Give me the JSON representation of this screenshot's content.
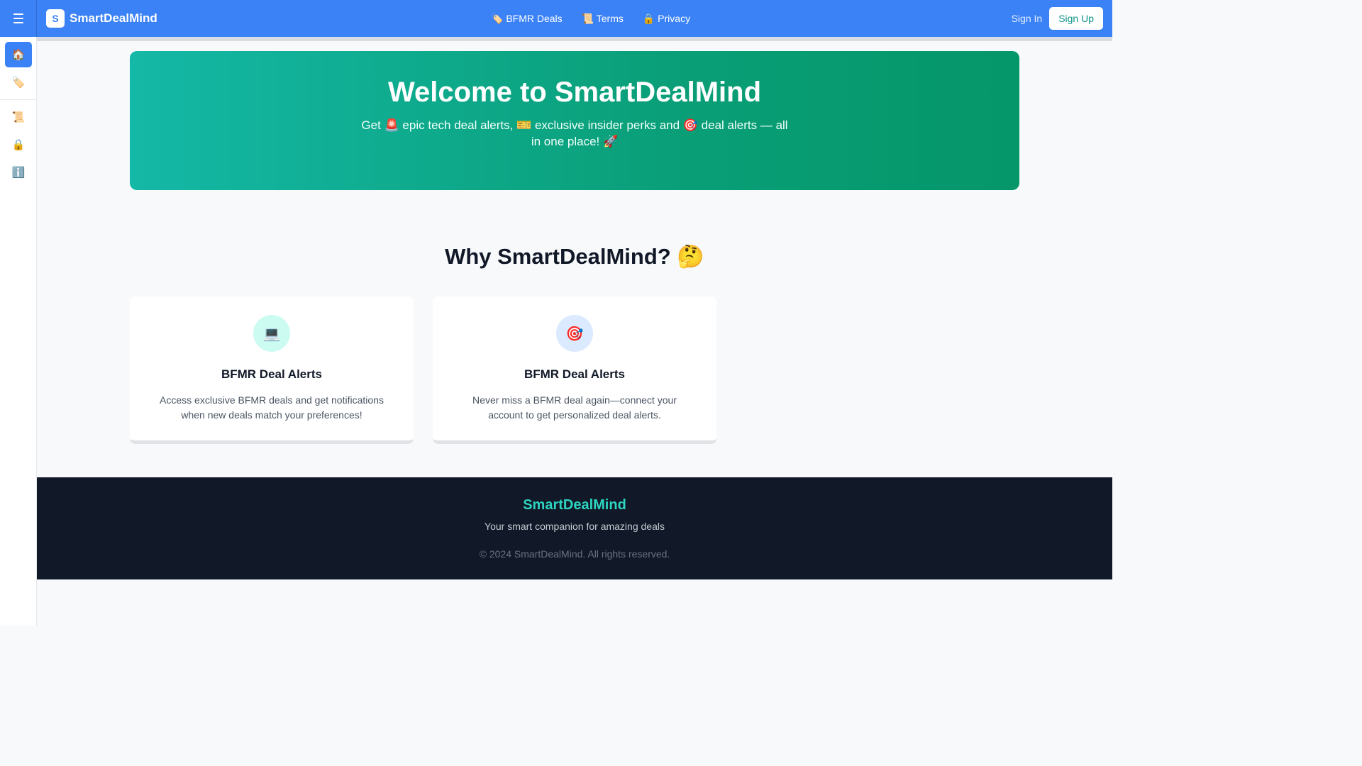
{
  "header": {
    "brand_initial": "S",
    "brand_name": "SmartDealMind",
    "nav": [
      {
        "label": "🏷️ BFMR Deals"
      },
      {
        "label": "📜 Terms"
      },
      {
        "label": "🔒 Privacy"
      }
    ],
    "sign_in": "Sign In",
    "sign_up": "Sign Up"
  },
  "sidebar": {
    "items": [
      {
        "icon": "🏠",
        "name": "home-icon",
        "active": true
      },
      {
        "icon": "🏷️",
        "name": "tag-icon",
        "active": false
      },
      {
        "icon": "📜",
        "name": "scroll-icon",
        "active": false
      },
      {
        "icon": "🔒",
        "name": "lock-icon",
        "active": false
      },
      {
        "icon": "ℹ️",
        "name": "info-icon",
        "active": false
      }
    ]
  },
  "hero": {
    "title": "Welcome to SmartDealMind",
    "subtitle": "Get 🚨 epic tech deal alerts, 🎫 exclusive insider perks and 🎯 deal alerts — all in one place! 🚀"
  },
  "why": {
    "title": "Why SmartDealMind? 🤔",
    "cards": [
      {
        "icon": "💻",
        "icon_name": "laptop-icon",
        "icon_bg": "#ccfbf1",
        "title": "BFMR Deal Alerts",
        "text": "Access exclusive BFMR deals and get notifications when new deals match your preferences!"
      },
      {
        "icon": "🎯",
        "icon_name": "target-icon",
        "icon_bg": "#dbeafe",
        "title": "BFMR Deal Alerts",
        "text": "Never miss a BFMR deal again—connect your account to get personalized deal alerts."
      }
    ]
  },
  "footer": {
    "brand": "SmartDealMind",
    "tagline": "Your smart companion for amazing deals",
    "copyright": "© 2024 SmartDealMind. All rights reserved."
  },
  "colors": {
    "primary": "#3b82f6",
    "hero_start": "#14b8a6",
    "hero_end": "#059669",
    "footer_bg": "#111827",
    "footer_brand": "#2dd4bf"
  }
}
